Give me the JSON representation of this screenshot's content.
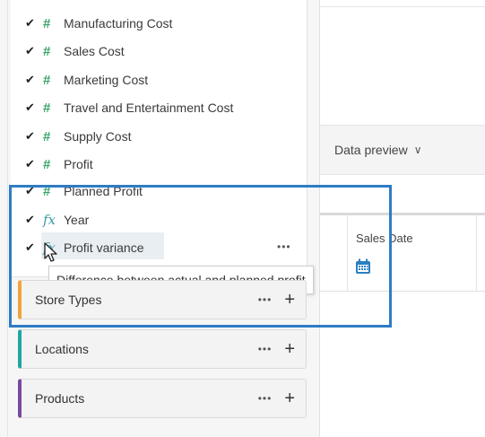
{
  "fields": [
    {
      "label": "Manufacturing Cost",
      "type": "measure",
      "checked": true
    },
    {
      "label": "Sales Cost",
      "type": "measure",
      "checked": true
    },
    {
      "label": "Marketing Cost",
      "type": "measure",
      "checked": true
    },
    {
      "label": "Travel and Entertainment Cost",
      "type": "measure",
      "checked": true
    },
    {
      "label": "Supply Cost",
      "type": "measure",
      "checked": true
    },
    {
      "label": "Profit",
      "type": "measure",
      "checked": true
    },
    {
      "label": "Planned Profit",
      "type": "measure",
      "checked": true
    },
    {
      "label": "Year",
      "type": "formula",
      "checked": true
    },
    {
      "label": "Profit variance",
      "type": "formula",
      "checked": true
    }
  ],
  "icons": {
    "check": "✔",
    "measure": "#",
    "formula": "fx",
    "more": "•••",
    "add": "+",
    "chevron": "∨"
  },
  "tooltip": "Difference between actual and planned profit",
  "folders": [
    {
      "label": "Store Types",
      "color": "#f0a33a"
    },
    {
      "label": "Locations",
      "color": "#1fa7a0"
    },
    {
      "label": "Products",
      "color": "#7a4a9c"
    }
  ],
  "preview": {
    "label": "Data preview"
  },
  "table": {
    "column_header": "Sales Date"
  },
  "colors": {
    "annotation": "#2f7cc4",
    "measure_icon": "#3aa46b",
    "formula_icon": "#3a9aaa",
    "row_highlight": "#e9eef3"
  }
}
